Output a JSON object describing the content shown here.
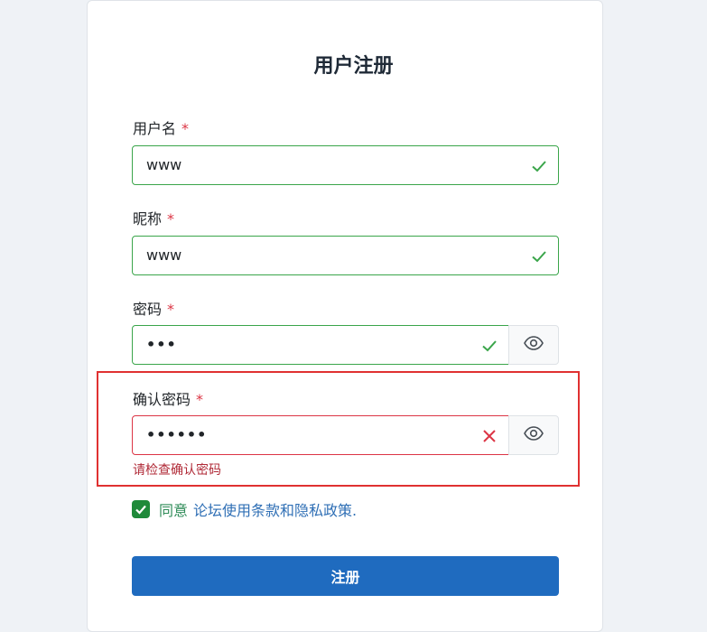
{
  "form": {
    "title": "用户注册",
    "username": {
      "label": "用户名",
      "required_mark": "*",
      "value": "www"
    },
    "nickname": {
      "label": "昵称",
      "required_mark": "*",
      "value": "www"
    },
    "password": {
      "label": "密码",
      "required_mark": "*",
      "value_masked": "•••"
    },
    "confirm_password": {
      "label": "确认密码",
      "required_mark": "*",
      "value_masked": "••••••",
      "error": "请检查确认密码"
    },
    "agree": {
      "checked": true,
      "text": "同意",
      "link_text": "论坛使用条款和隐私政策."
    },
    "submit_label": "注册"
  },
  "colors": {
    "valid": "#3aa54a",
    "invalid": "#dc3545",
    "primary": "#1f6bbf",
    "highlight": "#e03131"
  },
  "icons": {
    "valid": "check-icon",
    "invalid": "x-icon",
    "toggle_visibility": "eye-icon"
  }
}
